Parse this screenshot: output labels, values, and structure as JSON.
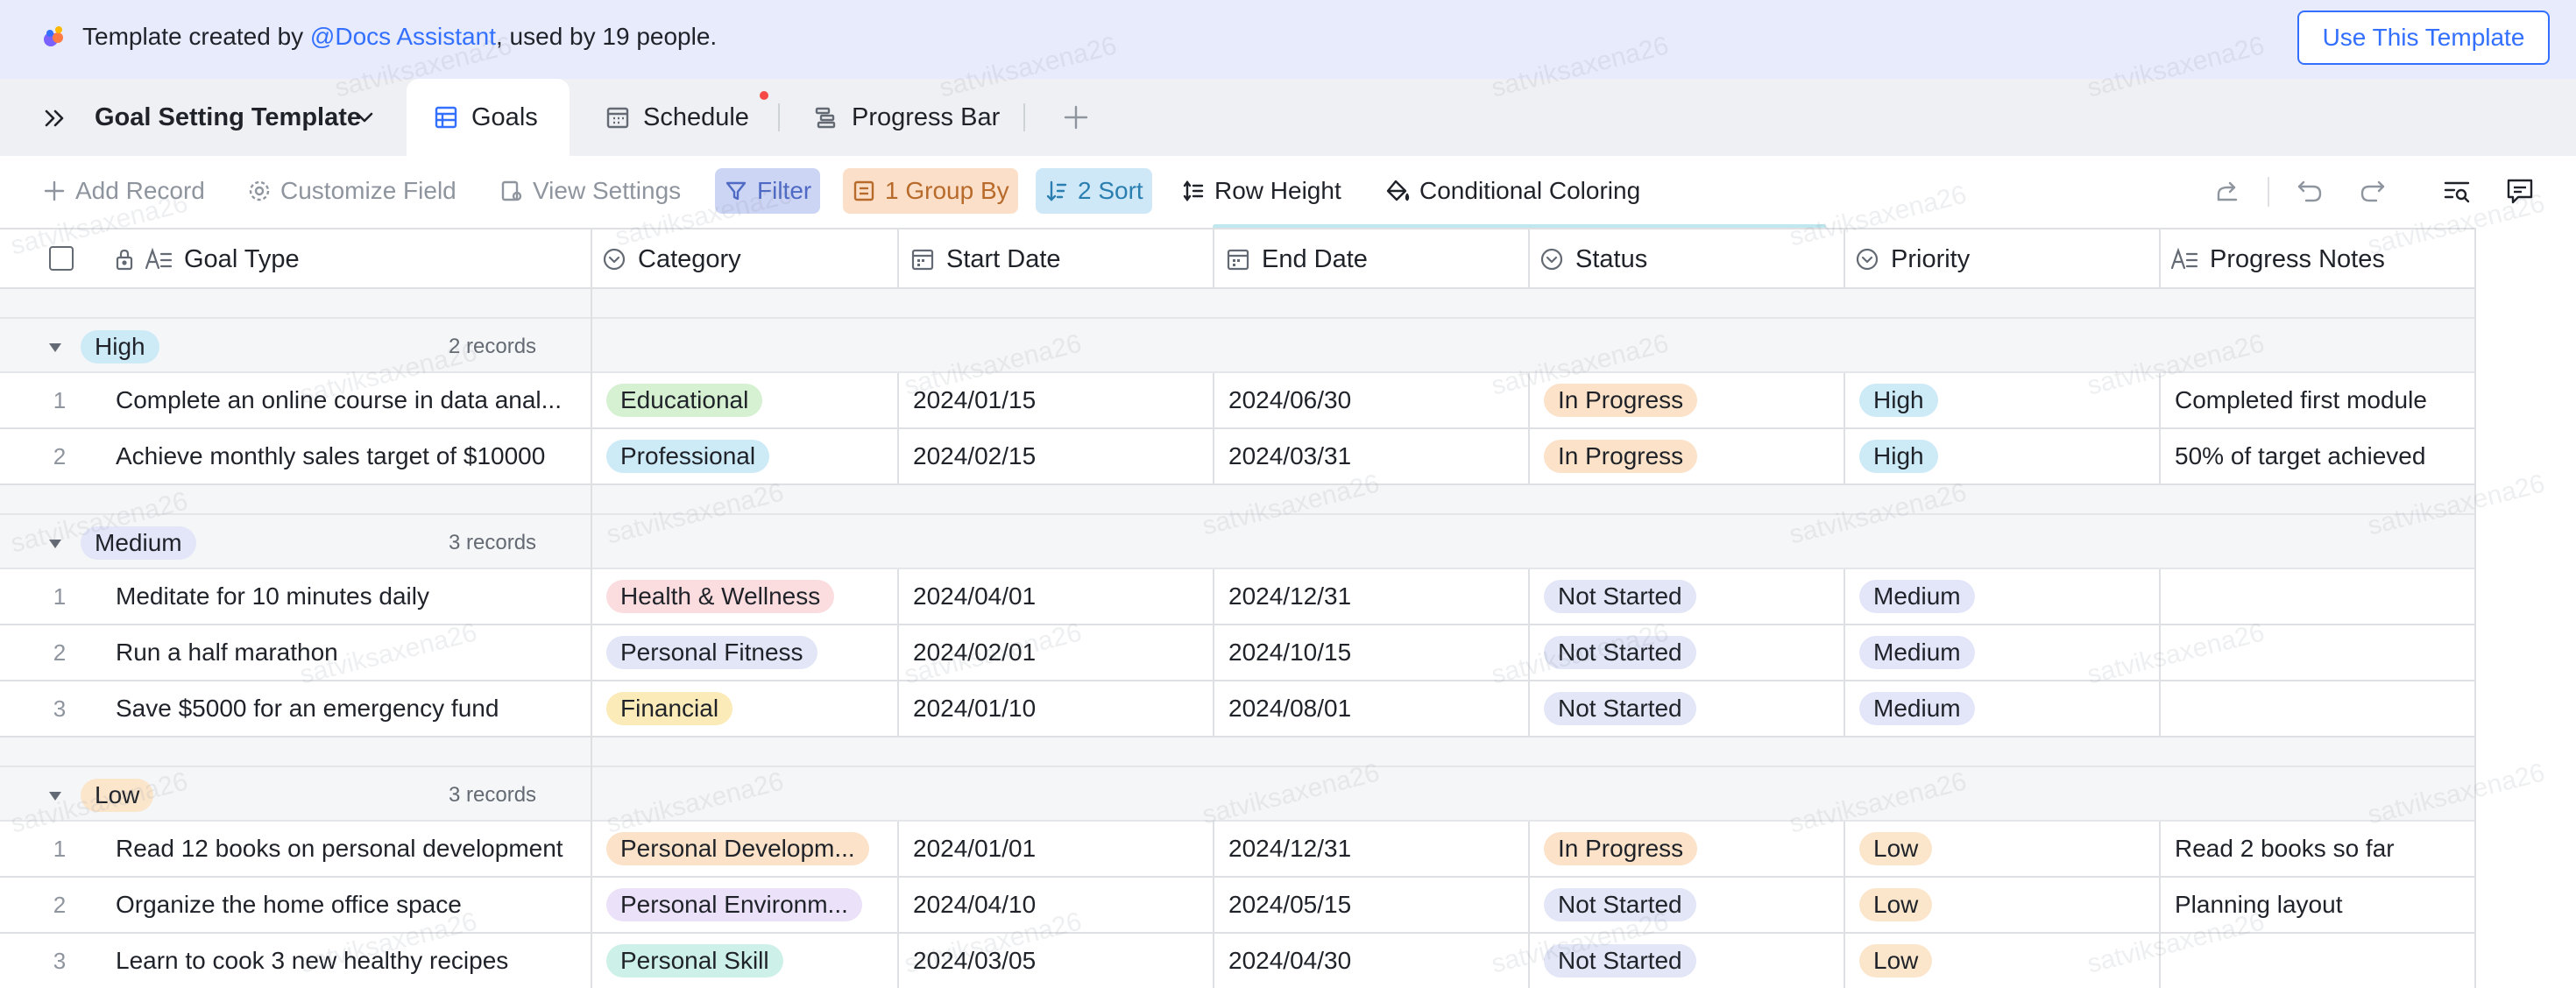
{
  "banner": {
    "prefix": "Template created by ",
    "author": "@Docs Assistant",
    "suffix": ", used by 19 people.",
    "button": "Use This Template"
  },
  "tabs": {
    "title": "Goal Setting Template",
    "items": [
      {
        "label": "Goals",
        "active": true
      },
      {
        "label": "Schedule",
        "active": false
      },
      {
        "label": "Progress Bar",
        "active": false
      }
    ]
  },
  "toolbar": {
    "add_record": "Add Record",
    "customize_field": "Customize Field",
    "view_settings": "View Settings",
    "filter": "Filter",
    "group_by": "1 Group By",
    "sort": "2 Sort",
    "row_height": "Row Height",
    "conditional_coloring": "Conditional Coloring"
  },
  "columns": {
    "goal_type": "Goal Type",
    "category": "Category",
    "start_date": "Start Date",
    "end_date": "End Date",
    "status": "Status",
    "priority": "Priority",
    "progress_notes": "Progress Notes"
  },
  "colors": {
    "accent": "#3370ff",
    "high": "#cdeaf7",
    "medium": "#e3e6f9",
    "low": "#fbe6cc",
    "in_progress": "#fbe2c8",
    "not_started": "#e2e6f6"
  },
  "groups": [
    {
      "label": "High",
      "count": "2 records",
      "rows": [
        {
          "num": "1",
          "goal": "Complete an online course in data anal...",
          "category": "Educational",
          "start": "2024/01/15",
          "end": "2024/06/30",
          "status": "In Progress",
          "priority": "High",
          "notes": "Completed first module"
        },
        {
          "num": "2",
          "goal": "Achieve monthly sales target of $10000",
          "category": "Professional",
          "start": "2024/02/15",
          "end": "2024/03/31",
          "status": "In Progress",
          "priority": "High",
          "notes": "50% of target achieved"
        }
      ]
    },
    {
      "label": "Medium",
      "count": "3 records",
      "rows": [
        {
          "num": "1",
          "goal": "Meditate for 10 minutes daily",
          "category": "Health & Wellness",
          "start": "2024/04/01",
          "end": "2024/12/31",
          "status": "Not Started",
          "priority": "Medium",
          "notes": ""
        },
        {
          "num": "2",
          "goal": "Run a half marathon",
          "category": "Personal Fitness",
          "start": "2024/02/01",
          "end": "2024/10/15",
          "status": "Not Started",
          "priority": "Medium",
          "notes": ""
        },
        {
          "num": "3",
          "goal": "Save $5000 for an emergency fund",
          "category": "Financial",
          "start": "2024/01/10",
          "end": "2024/08/01",
          "status": "Not Started",
          "priority": "Medium",
          "notes": ""
        }
      ]
    },
    {
      "label": "Low",
      "count": "3 records",
      "rows": [
        {
          "num": "1",
          "goal": "Read 12 books on personal development",
          "category": "Personal Developm...",
          "start": "2024/01/01",
          "end": "2024/12/31",
          "status": "In Progress",
          "priority": "Low",
          "notes": "Read 2 books so far"
        },
        {
          "num": "2",
          "goal": "Organize the home office space",
          "category": "Personal Environm...",
          "start": "2024/04/10",
          "end": "2024/05/15",
          "status": "Not Started",
          "priority": "Low",
          "notes": "Planning layout"
        },
        {
          "num": "3",
          "goal": "Learn to cook 3 new healthy recipes",
          "category": "Personal Skill",
          "start": "2024/03/05",
          "end": "2024/04/30",
          "status": "Not Started",
          "priority": "Low",
          "notes": ""
        }
      ]
    }
  ],
  "watermark": "satviksaxena26"
}
